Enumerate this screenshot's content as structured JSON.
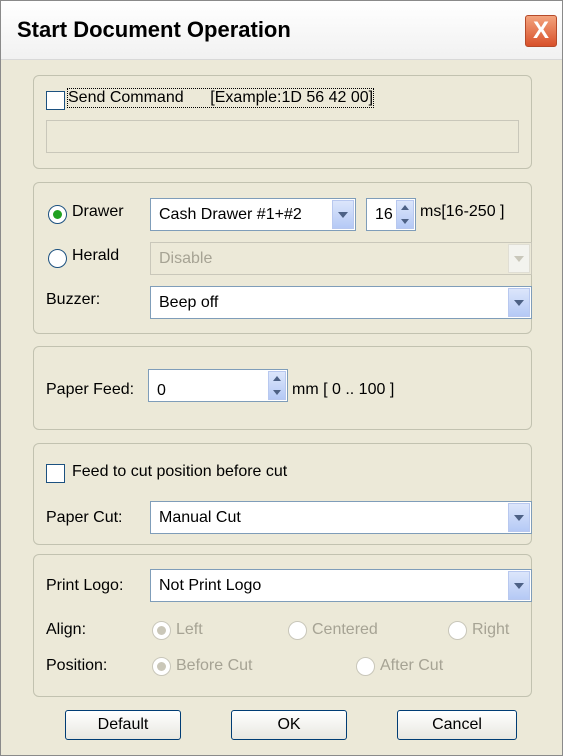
{
  "dialog": {
    "title": "Start Document Operation",
    "close_symbol": "X"
  },
  "command": {
    "send_label": "Send Command",
    "example": "[Example:1D 56 42 00]",
    "send_checked": false,
    "input_value": ""
  },
  "drawer": {
    "drawer_label": "Drawer",
    "drawer_selected": true,
    "drawer_value": "Cash Drawer #1+#2",
    "ms_value": "16",
    "ms_range": "ms[16-250 ]",
    "herald_label": "Herald",
    "herald_selected": false,
    "herald_value": "Disable",
    "buzzer_label": "Buzzer:",
    "buzzer_value": "Beep off"
  },
  "paper_feed": {
    "label": "Paper Feed:",
    "value": "0",
    "range": "mm [ 0 .. 100 ]"
  },
  "cut": {
    "feed_label": "Feed to cut position before cut",
    "feed_checked": false,
    "cut_label": "Paper Cut:",
    "cut_value": "Manual Cut"
  },
  "logo": {
    "print_label": "Print Logo:",
    "print_value": "Not Print Logo",
    "align_label": "Align:",
    "align_left": "Left",
    "align_centered": "Centered",
    "align_right": "Right",
    "position_label": "Position:",
    "before_cut": "Before Cut",
    "after_cut": "After Cut"
  },
  "buttons": {
    "default": "Default",
    "ok": "OK",
    "cancel": "Cancel"
  },
  "colors": {
    "accent": "#21a121",
    "close": "#d8502a",
    "border": "#003c74"
  }
}
